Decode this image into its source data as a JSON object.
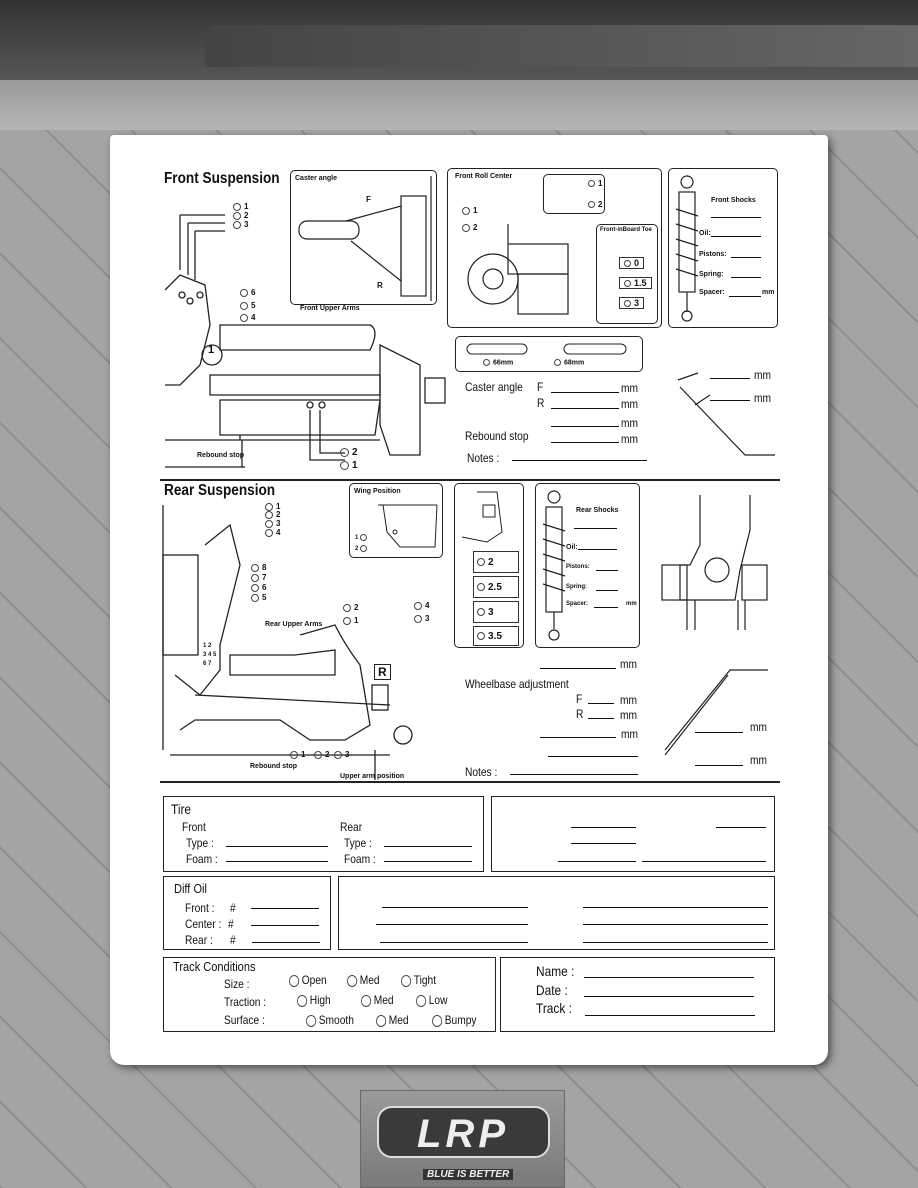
{
  "front": {
    "title": "Front Suspension",
    "caster_box": "Caster angle",
    "F": "F",
    "R": "R",
    "upper_arms": "Front Upper Arms",
    "rebound": "Rebound stop",
    "holes_top": [
      "1",
      "2",
      "3"
    ],
    "holes_side": [
      "6",
      "5",
      "4"
    ],
    "holes_bottom": [
      "2",
      "1"
    ],
    "plate_num": "1",
    "roll_center": "Front Roll Center",
    "rc_opts": [
      "1",
      "2"
    ],
    "rc_top": [
      "1",
      "2"
    ],
    "inboard_toe": "Front-inBoard Toe",
    "toe_opts": [
      "0",
      "1.5",
      "3"
    ],
    "shocks": {
      "title": "Front Shocks",
      "oil": "Oil:",
      "pistons": "Pistons:",
      "spring": "Spring:",
      "spacer": "Spacer:",
      "mm": "mm"
    },
    "arms": [
      "66mm",
      "68mm"
    ],
    "caster_label": "Caster angle",
    "caster_F": "F",
    "caster_R": "R",
    "mm": "mm",
    "rebound_label": "Rebound stop",
    "notes": "Notes :"
  },
  "rear": {
    "title": "Rear Suspension",
    "wing": "Wing Position",
    "wing_opts": [
      "1",
      "2"
    ],
    "holes_top": [
      "1",
      "2",
      "3",
      "4"
    ],
    "holes_side": [
      "8",
      "7",
      "6",
      "5"
    ],
    "upper_arms": "Rear Upper Arms",
    "plate_nums": [
      "1",
      "2",
      "3",
      "4",
      "5",
      "6",
      "7"
    ],
    "hub_top": [
      "2",
      "1",
      "4",
      "3"
    ],
    "hub_label": "R",
    "bottom_holes": [
      "1",
      "2",
      "3"
    ],
    "rebound": "Rebound stop",
    "upper_arm_pos": "Upper arm position",
    "toe_opts": [
      "2",
      "2.5",
      "3",
      "3.5"
    ],
    "shocks": {
      "title": "Rear Shocks",
      "oil": "Oil:",
      "pistons": "Pistons:",
      "spring": "Spring:",
      "spacer": "Spacer:",
      "mm": "mm"
    },
    "mm": "mm",
    "wheelbase": "Wheelbase adjustment",
    "wb_F": "F",
    "wb_R": "R",
    "notes": "Notes :"
  },
  "tire": {
    "title": "Tire",
    "front": "Front",
    "rear": "Rear",
    "type": "Type :",
    "foam": "Foam :"
  },
  "diff": {
    "title": "Diff Oil",
    "front": "Front :",
    "center": "Center :",
    "rear": "Rear :",
    "hash": "#"
  },
  "track": {
    "title": "Track Conditions",
    "size": "Size  :",
    "traction": "Traction :",
    "surface": "Surface :",
    "size_opts": [
      "Open",
      "Med",
      "Tight"
    ],
    "traction_opts": [
      "High",
      "Med",
      "Low"
    ],
    "surface_opts": [
      "Smooth",
      "Med",
      "Bumpy"
    ]
  },
  "info": {
    "name": "Name :",
    "date": "Date :",
    "track": "Track :"
  },
  "logo": {
    "brand": "LRP",
    "slogan": "BLUE IS BETTER"
  }
}
